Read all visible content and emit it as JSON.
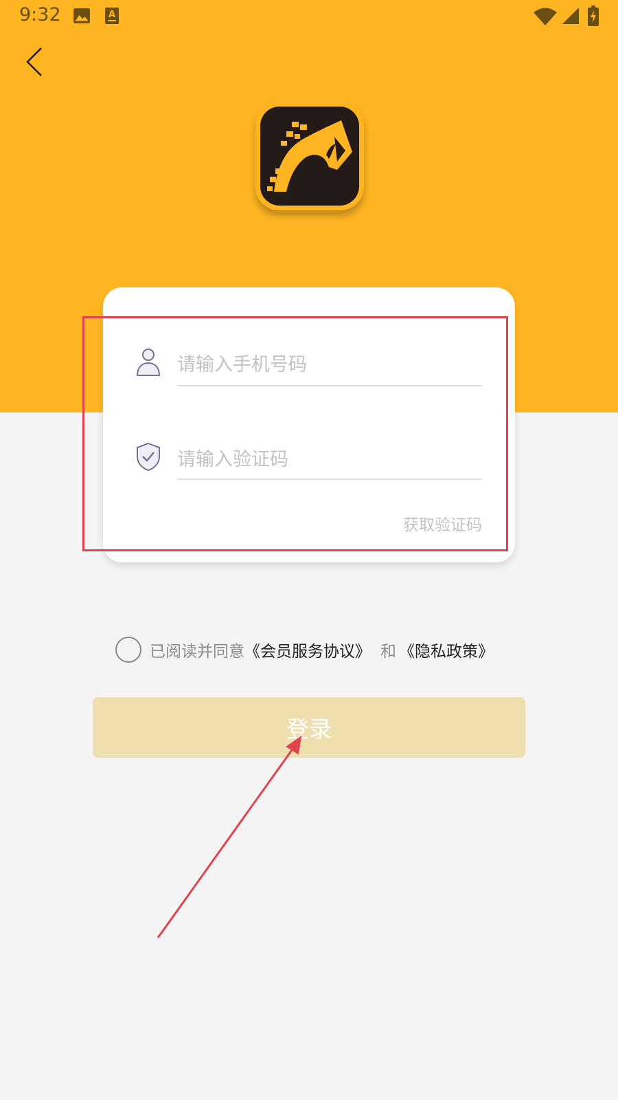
{
  "status_bar": {
    "time": "9:32",
    "icons": [
      "image-icon",
      "keyboard-a-icon",
      "wifi-icon",
      "signal-icon",
      "battery-charging-icon"
    ]
  },
  "nav": {
    "back_icon": "chevron-left-icon"
  },
  "logo": {
    "icon": "horse-head-icon",
    "colors": {
      "frame": "#ffb522",
      "tile": "#241b18",
      "mark": "#ffb522"
    }
  },
  "form": {
    "phone": {
      "icon": "user-icon",
      "placeholder": "请输入手机号码",
      "value": ""
    },
    "code": {
      "icon": "shield-check-icon",
      "placeholder": "请输入验证码",
      "value": ""
    },
    "get_code_label": "获取验证码"
  },
  "agreement": {
    "checked": false,
    "prefix": "已阅读并同意",
    "member_link": "《会员服务协议》",
    "and": "和",
    "privacy_link": "《隐私政策》"
  },
  "login_button": {
    "label": "登录"
  },
  "colors": {
    "brand": "#ffb522",
    "page_bg": "#f4f4f4",
    "button_disabled": "#efdeae",
    "annotation": "#e0444e"
  }
}
